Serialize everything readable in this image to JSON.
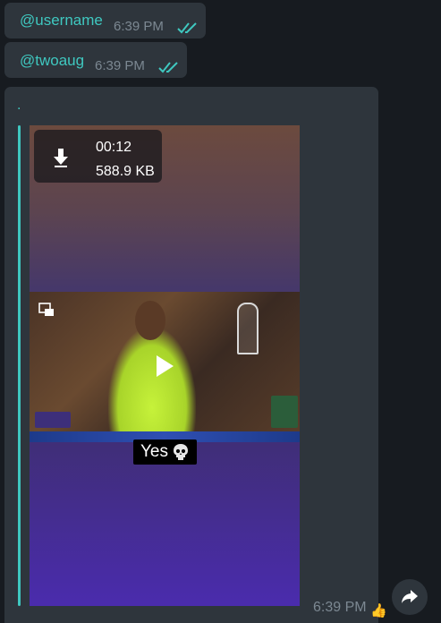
{
  "messages": [
    {
      "mention": "@username",
      "time": "6:39 PM",
      "status_icon": "double-check-icon"
    },
    {
      "mention": "@twoaug",
      "time": "6:39 PM",
      "status_icon": "double-check-icon"
    }
  ],
  "media_message": {
    "text": ".",
    "video": {
      "duration": "00:12",
      "size": "588.9 KB",
      "caption_text": "Yes",
      "caption_emoji": "skull-icon"
    },
    "time": "6:39 PM",
    "reaction": "👍"
  },
  "colors": {
    "accent": "#3fc8c0",
    "bubble": "#2e353c",
    "background": "#171b20",
    "meta_text": "#7c8892"
  }
}
